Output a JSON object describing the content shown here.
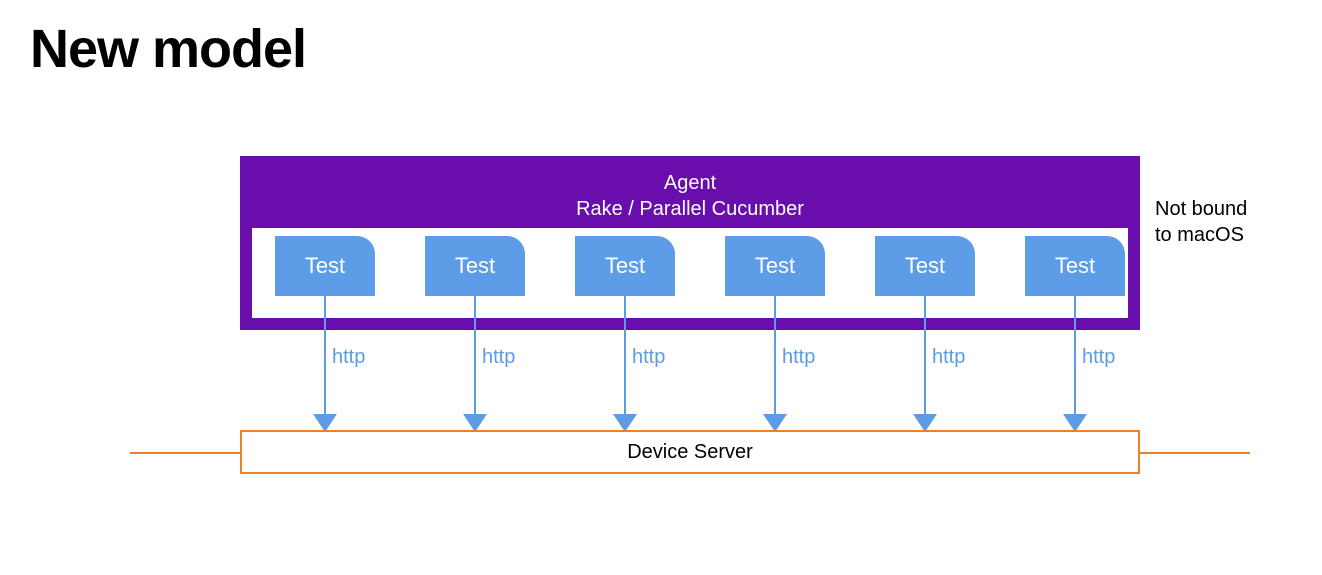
{
  "title": "New model",
  "agent": {
    "line1": "Agent",
    "line2": "Rake / Parallel Cucumber"
  },
  "tests": [
    {
      "label": "Test",
      "connection": "http"
    },
    {
      "label": "Test",
      "connection": "http"
    },
    {
      "label": "Test",
      "connection": "http"
    },
    {
      "label": "Test",
      "connection": "http"
    },
    {
      "label": "Test",
      "connection": "http"
    },
    {
      "label": "Test",
      "connection": "http"
    }
  ],
  "device_server": "Device Server",
  "note": {
    "line1": "Not bound",
    "line2": "to macOS"
  },
  "colors": {
    "agent_bg": "#6a0dad",
    "test_bg": "#5d9ce6",
    "device_border": "#e9822b"
  }
}
